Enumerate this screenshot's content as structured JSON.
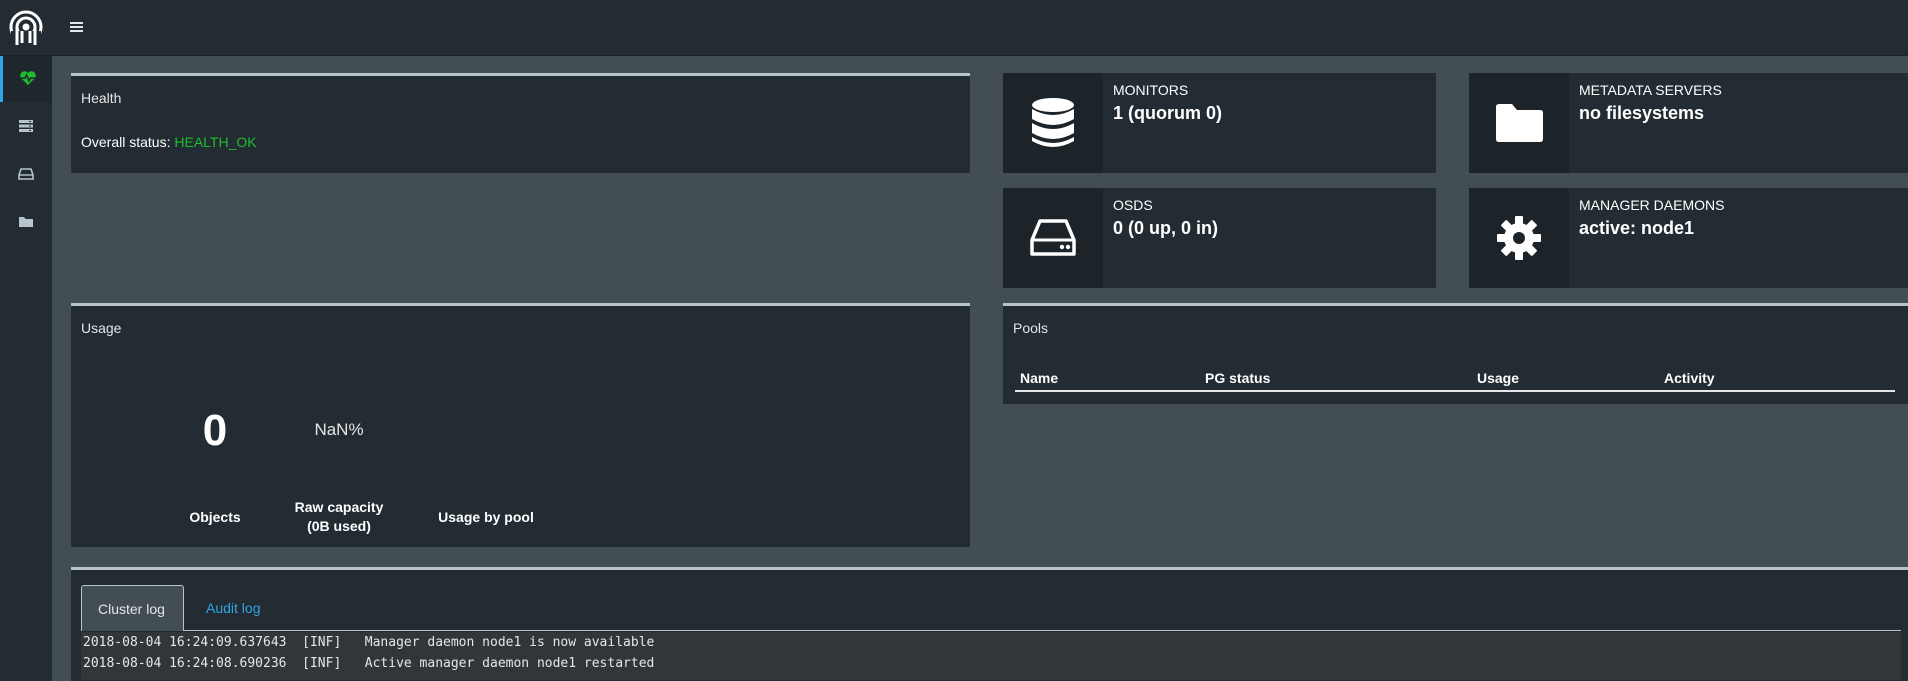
{
  "sidebar": {
    "items": [
      {
        "icon": "heartbeat-icon",
        "active": true
      },
      {
        "icon": "server-icon",
        "active": false
      },
      {
        "icon": "hard-drive-icon",
        "active": false
      },
      {
        "icon": "folder-icon",
        "active": false
      }
    ]
  },
  "health": {
    "title": "Health",
    "status_label": "Overall status:",
    "status_value": "HEALTH_OK",
    "status_color": "#1fbd2f"
  },
  "info_boxes": {
    "monitors": {
      "label": "MONITORS",
      "value": "1 (quorum 0)",
      "icon": "database-icon"
    },
    "metadata": {
      "label": "METADATA SERVERS",
      "value": "no filesystems",
      "icon": "folder-icon"
    },
    "osds": {
      "label": "OSDS",
      "value": "0 (0 up, 0 in)",
      "icon": "hard-drive-icon"
    },
    "managers": {
      "label": "MANAGER DAEMONS",
      "value": "active: node1",
      "icon": "gear-icon"
    }
  },
  "usage": {
    "title": "Usage",
    "objects_value": "0",
    "objects_label": "Objects",
    "raw_pct": "NaN%",
    "raw_label_1": "Raw capacity",
    "raw_label_2": "(0B used)",
    "by_pool_label": "Usage by pool"
  },
  "pools": {
    "title": "Pools",
    "columns": [
      "Name",
      "PG status",
      "Usage",
      "Activity"
    ]
  },
  "logs": {
    "tabs": [
      "Cluster log",
      "Audit log"
    ],
    "active_tab": 0,
    "lines": [
      "2018-08-04 16:24:09.637643  [INF]   Manager daemon node1 is now available",
      "2018-08-04 16:24:08.690236  [INF]   Active manager daemon node1 restarted"
    ]
  },
  "colors": {
    "accent": "#2fa4e7",
    "background": "#424d54",
    "panel": "#222c32",
    "ok_green": "#1fbd2f"
  }
}
